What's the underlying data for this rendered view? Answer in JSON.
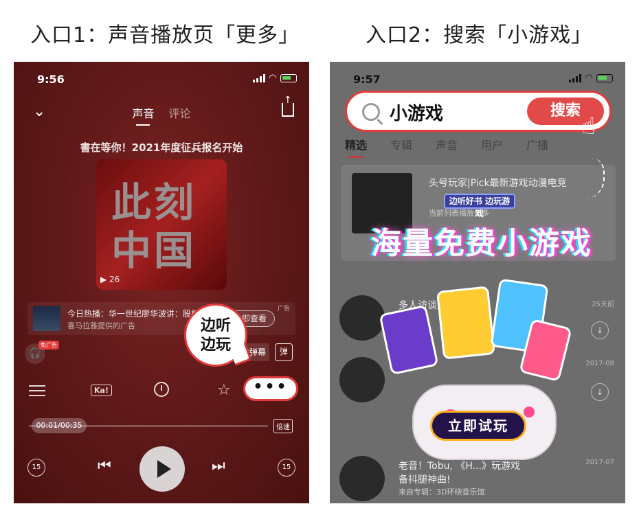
{
  "captions": {
    "left": "入口1：声音播放页「更多」",
    "right": "入口2：搜索「小游戏」"
  },
  "left_phone": {
    "status_time": "9:56",
    "tabs": [
      "声音",
      "评论"
    ],
    "track_title": "書在等你！2021年度征兵报名开始",
    "cover_text_line1": "此刻",
    "cover_text_line2": "中国",
    "cover_plays": "▶ 26",
    "ad": {
      "line1": "今日热播：华一世纪廖华波讲：股权",
      "line2": "喜马拉雅提供的广告",
      "tag": "广告",
      "button": "立即查看"
    },
    "noad_badge": "免广告",
    "danmu_button": "发弹幕",
    "danmu_icon": "弹",
    "bubble_line1": "边听",
    "bubble_line2": "边玩",
    "controls": {
      "ka": "Ka!",
      "star": "☆",
      "more": "•••"
    },
    "progress": {
      "time": "00:01/00:35",
      "fraction": 0.03
    },
    "speed": "倍速",
    "skip_back": "15",
    "skip_forward": "15"
  },
  "right_phone": {
    "status_time": "9:57",
    "search_text": "小游戏",
    "search_button": "搜索",
    "tabs": [
      "精选",
      "专辑",
      "声音",
      "用户",
      "广播"
    ],
    "result": {
      "title": "头号玩家|Pick最新游戏动漫电竞",
      "sub": "当前列表播放最多"
    },
    "promo": {
      "badge": "边听好书 边玩游戏",
      "title": "海量免费小游戏",
      "button": "立即试玩"
    },
    "list": [
      {
        "title": "多人访谈大家聊",
        "title2": "",
        "meta": "",
        "date": "25天前"
      },
      {
        "title": "",
        "title2": "",
        "meta": "",
        "date": "2017-08"
      },
      {
        "title": "老音！Tobu, 《H...》玩游戏",
        "title2": "备抖腿神曲!",
        "meta": "来自专辑：3D环绕音乐馆",
        "date": "2017-07"
      }
    ]
  }
}
